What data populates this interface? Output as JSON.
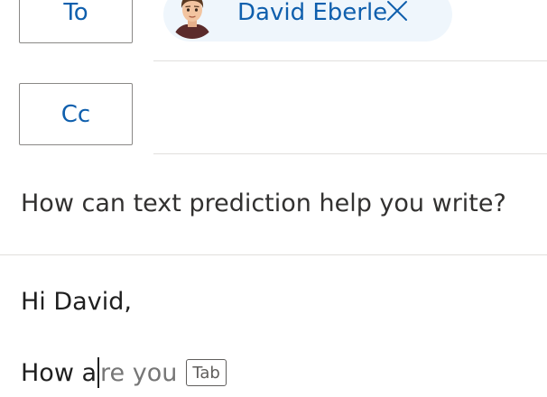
{
  "to_button_label": "To",
  "cc_button_label": "Cc",
  "recipient": {
    "name": "David Eberle",
    "remove_icon": "close-icon",
    "avatar_icon": "person-avatar"
  },
  "subject": "How can text prediction help you write?",
  "body": {
    "greeting": "Hi David,",
    "typed_before_caret": "How a",
    "predicted_text": "re you",
    "accept_key_label": "Tab"
  },
  "colors": {
    "accent": "#0f5fad",
    "chip_background": "#eff6fc",
    "prediction_text": "#767676",
    "divider": "#e1dfdd"
  }
}
